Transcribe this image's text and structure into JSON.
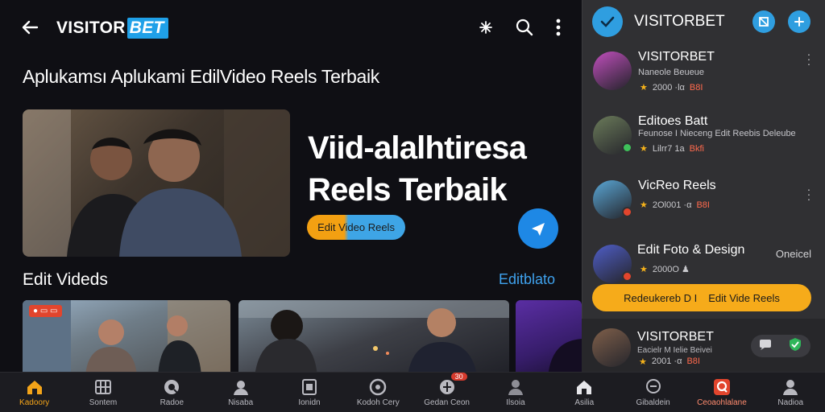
{
  "app": {
    "brand_main": "VISITOR",
    "brand_accent": "BET"
  },
  "page": {
    "heading": "Aplukamsı Aplukami EdilVideo Reels Terbaik"
  },
  "hero": {
    "title_line1": "Viid-alalhtiresa",
    "title_line2": "Reels Terbaik",
    "pill_label": "Edit Video Reels"
  },
  "section": {
    "title": "Edit Videds",
    "link": "Editblato"
  },
  "thumbs": [
    {
      "tag": "● ▭ ▭"
    }
  ],
  "nav": [
    {
      "label": "Kadoory",
      "icon": "home-icon"
    },
    {
      "label": "Sontem",
      "icon": "grid-icon"
    },
    {
      "label": "Radoe",
      "icon": "radio-icon"
    },
    {
      "label": "Nisaba",
      "icon": "user-icon"
    },
    {
      "label": "Ionidn",
      "icon": "window-icon"
    },
    {
      "label": "Kodoh Cery",
      "icon": "wheel-icon"
    },
    {
      "label": "Gedan Ceon",
      "icon": "globe-icon",
      "badge": "30"
    },
    {
      "label": "Ilsoia",
      "icon": "person-icon"
    },
    {
      "label": "Asilia",
      "icon": "home-icon"
    },
    {
      "label": "Gibaldein",
      "icon": "chat-icon"
    },
    {
      "label": "Ceoaohlalane",
      "icon": "q-icon"
    },
    {
      "label": "Nadioa",
      "icon": "profile-icon"
    }
  ],
  "panel": {
    "title": "VISITORBET",
    "items": [
      {
        "name": "VISITORBET",
        "sub": "Naneole Beueue",
        "rating": "2000 ·lα",
        "tag": "B8I"
      },
      {
        "name": "Editoes Batt",
        "sub": "Feunose I Nieceng  Edit Reebis Deleube",
        "rating": "Lilrr7 1a",
        "tag": "Bkfi"
      },
      {
        "name": "VicReo Reels",
        "sub": "",
        "rating": "2Ol001 ·α",
        "tag": "B8I"
      },
      {
        "name": "Edit Foto & Design",
        "sub": "",
        "rating": "2000O ♟",
        "tag": "",
        "right": "Oneicel"
      }
    ],
    "cta_left": "Redeukereb D I",
    "cta_right": "Edit Vide Reels",
    "last": {
      "name": "VISITORBET",
      "sub": "Eacielr M Ielie Beivei",
      "rating": "2001 ·α",
      "tag": "B8I"
    }
  },
  "colors": {
    "accent": "#1fa0e8",
    "orange": "#f6ab1a",
    "panel": "#303033",
    "nav_active": "#f4a419"
  }
}
